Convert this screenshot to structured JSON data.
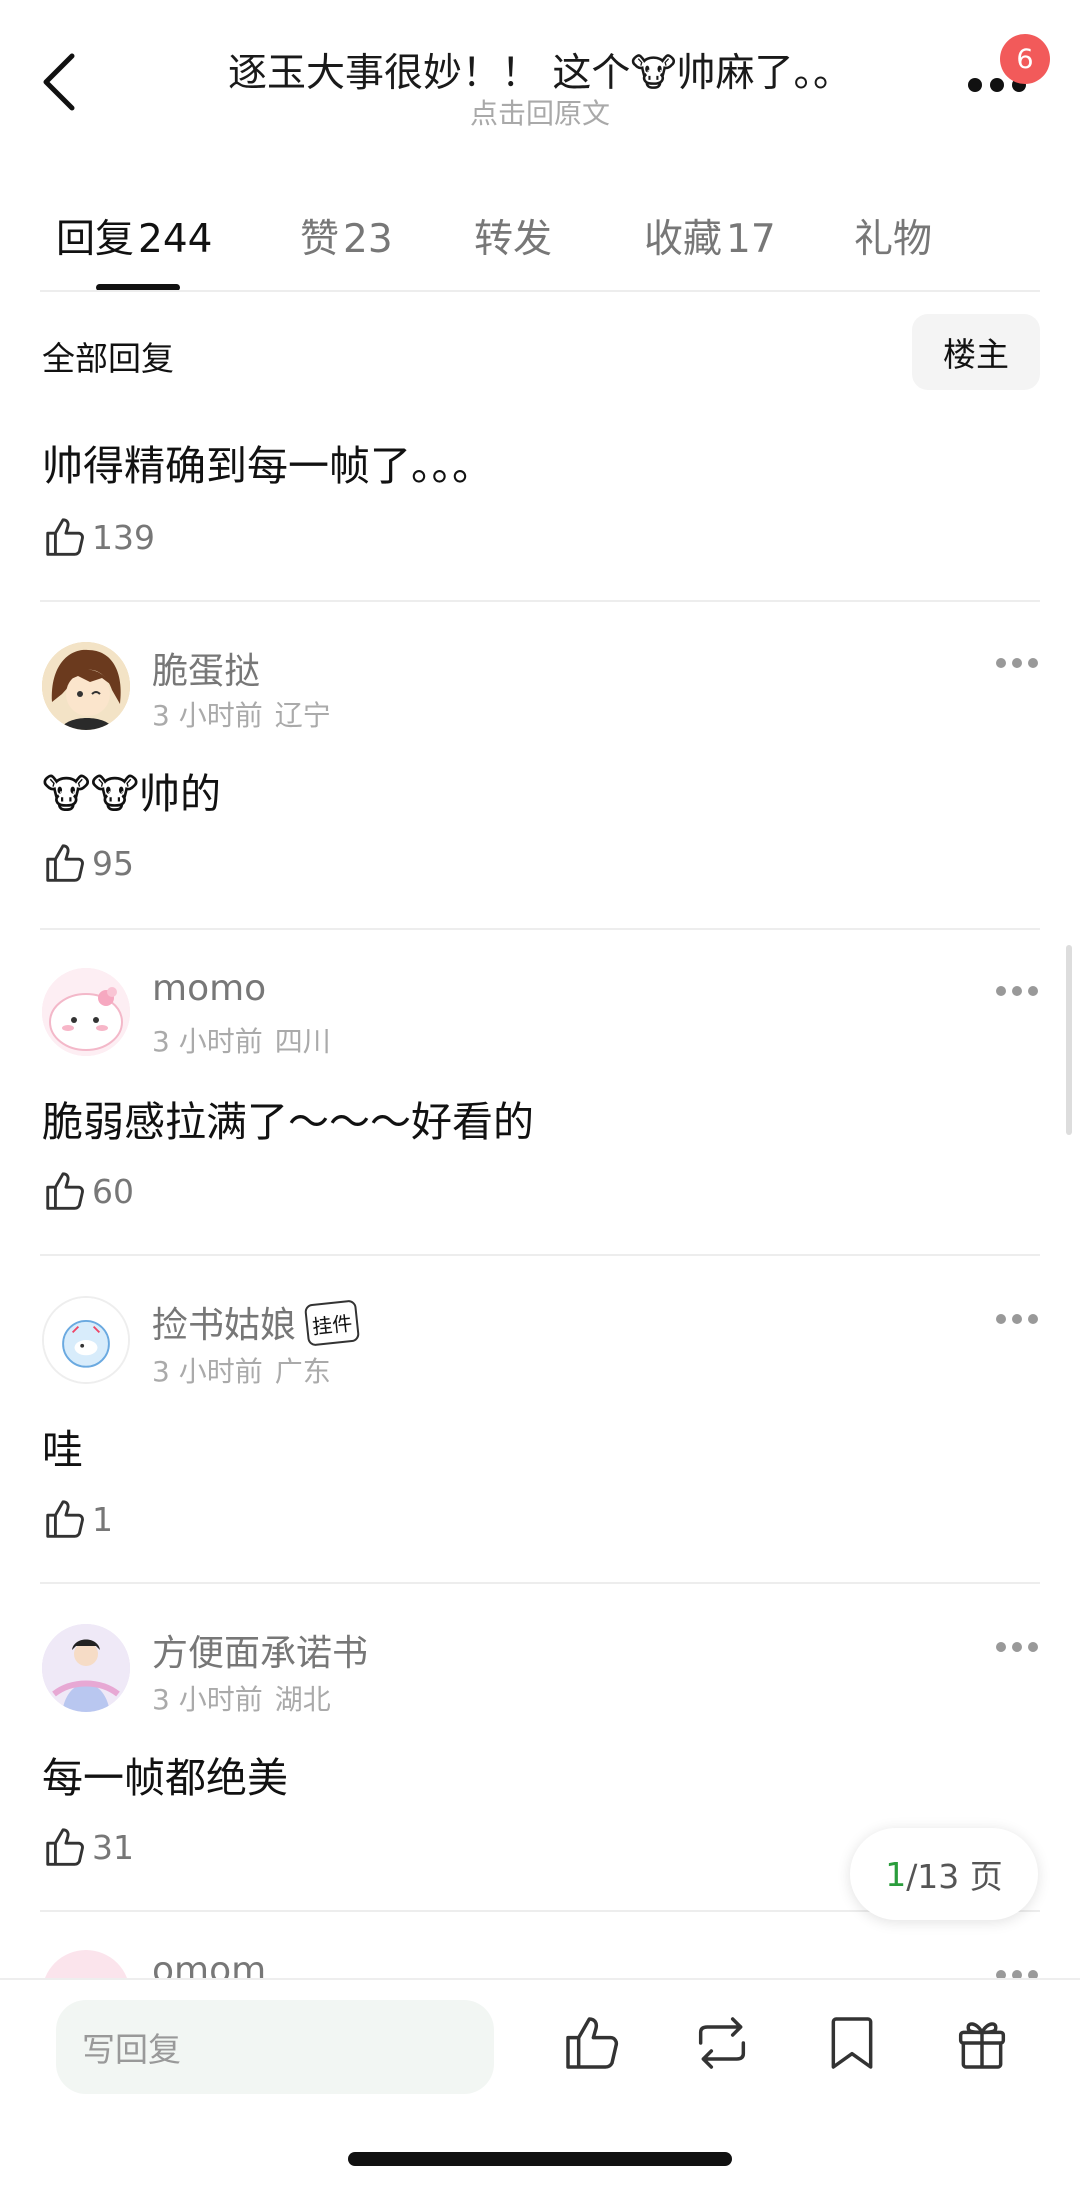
{
  "header": {
    "title": "逐玉大事很妙！！ 这个🐮帅麻了。。",
    "subtitle": "点击回原文",
    "notification_count": "6"
  },
  "tabs": [
    {
      "label": "回复",
      "count": "244",
      "active": true
    },
    {
      "label": "赞",
      "count": "23",
      "active": false
    },
    {
      "label": "转发",
      "count": "",
      "active": false
    },
    {
      "label": "收藏",
      "count": "17",
      "active": false
    },
    {
      "label": "礼物",
      "count": "",
      "active": false
    }
  ],
  "section": {
    "title": "全部回复",
    "filter_label": "楼主"
  },
  "original_post": {
    "text": "帅得精确到每一帧了。。。",
    "likes": "139"
  },
  "comments": [
    {
      "username": "脆蛋挞",
      "time": "3 小时前",
      "location": "辽宁",
      "text": "🐮🐮帅的",
      "likes": "95"
    },
    {
      "username": "momo",
      "time": "3 小时前",
      "location": "四川",
      "text": "脆弱感拉满了～～～好看的",
      "likes": "60"
    },
    {
      "username": "捡书姑娘",
      "pendant": "挂件",
      "time": "3 小时前",
      "location": "广东",
      "text": "哇",
      "likes": "1"
    },
    {
      "username": "方便面承诺书",
      "time": "3 小时前",
      "location": "湖北",
      "text": "每一帧都绝美",
      "likes": "31"
    },
    {
      "username": "omom"
    }
  ],
  "pager": {
    "current": "1",
    "total_text": "/13 页"
  },
  "bottom_bar": {
    "reply_placeholder": "写回复",
    "icons": [
      "like-icon",
      "repost-icon",
      "bookmark-icon",
      "gift-icon"
    ]
  },
  "colors": {
    "badge": "#f25a5a",
    "pager_current": "#2a9d3c",
    "input_bg": "#f2f6f3"
  }
}
